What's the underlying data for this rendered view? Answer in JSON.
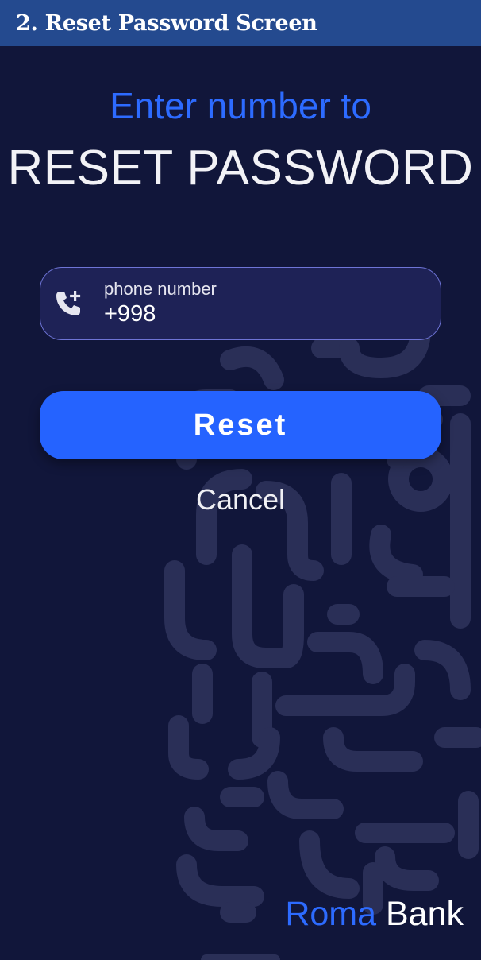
{
  "caption": "2. Reset Password Screen",
  "header": {
    "line1": "Enter number to",
    "line2": "RESET PASSWORD"
  },
  "phone_field": {
    "label": "phone number",
    "value": "+998",
    "icon": "phone-add-icon"
  },
  "reset_button": {
    "label": "Reset"
  },
  "cancel_link": {
    "label": "Cancel"
  },
  "brand": {
    "part1": "Roma",
    "part2": "Bank"
  },
  "colors": {
    "background": "#11163a",
    "accent": "#2563ff",
    "caption_bar": "#244a8f",
    "field_border": "#6e74d6",
    "pattern": "#2a2f57"
  }
}
